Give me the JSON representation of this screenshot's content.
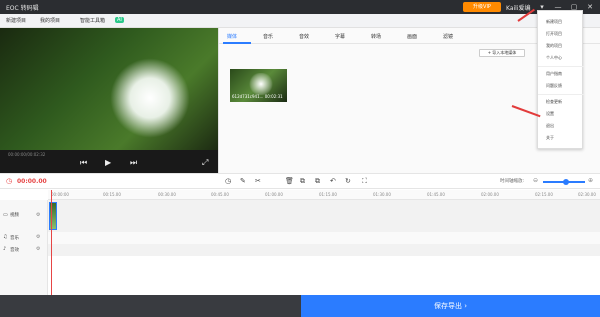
{
  "window": {
    "app_name": "EOC 转码辑",
    "vip_button": "升级VIP",
    "user": "Kaili爱编",
    "controls": [
      "▾",
      "—",
      "▢",
      "✕"
    ]
  },
  "toolbar": {
    "items": [
      "新建项目",
      "我的项目",
      "智能工具箱"
    ],
    "ai_badge": "AI"
  },
  "preview": {
    "time": "00:00:00/00:02:32",
    "controls": [
      "⏮",
      "▶",
      "⏭",
      "⤢"
    ]
  },
  "media": {
    "tabs": [
      "媒体",
      "音乐",
      "音效",
      "字幕",
      "转场",
      "画面",
      "滤镜"
    ],
    "active_tab": 0,
    "import_button": "+ 导入本地媒体",
    "clip_label": "612d731c941...  00:02:31"
  },
  "menu": {
    "items": [
      "新建项目",
      "打开项目",
      "我的项目",
      "个人中心",
      "用户指南",
      "问题反馈",
      "检查更新",
      "设置",
      "退出",
      "关于"
    ]
  },
  "timeline": {
    "current_time": "00:00.00",
    "tools": [
      "◷",
      "✎",
      "✂",
      "🗑",
      "⧉",
      "⧉",
      "↶",
      "↻",
      "⛶"
    ],
    "zoom_label": "时间轴缩放:",
    "zoom_level": 0.55,
    "ruler": [
      "00:00:00",
      "00:15.00",
      "00:30.00",
      "00:45.00",
      "01:00.00",
      "01:15.00",
      "01:30.00",
      "01:45.00",
      "02:00.00",
      "02:15.00",
      "02:30.00"
    ],
    "tracks": [
      "视频",
      "音乐",
      "音效"
    ]
  },
  "footer": {
    "export_button": "保存导出 ›"
  },
  "colors": {
    "accent": "#2b7cff",
    "vip": "#ff8a00",
    "playhead": "#e64545",
    "ai": "#2bc88a",
    "annotation_arrow": "#e23b3b"
  }
}
